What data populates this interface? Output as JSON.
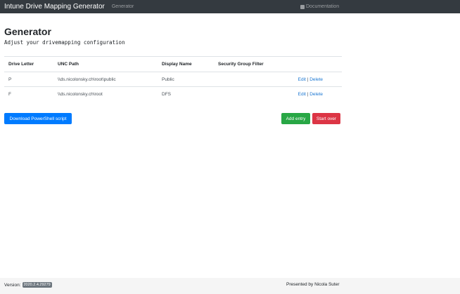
{
  "navbar": {
    "brand": "Intune Drive Mapping Generator",
    "nav_generator": "Generator",
    "documentation": "Documentation",
    "documentation_icon": "book-icon"
  },
  "main": {
    "title": "Generator",
    "subtitle": "Adjust your drivemapping configuration"
  },
  "table": {
    "headers": [
      "Drive Letter",
      "UNC Path",
      "Display Name",
      "Security Group Filter",
      ""
    ],
    "rows": [
      {
        "drive": "P",
        "unc": "\\\\ds.nicolonsky.ch\\root\\public",
        "display": "Public",
        "group": "",
        "edit": "Edit",
        "sep": "|",
        "delete": "Delete"
      },
      {
        "drive": "F",
        "unc": "\\\\ds.nicolonsky.ch\\root",
        "display": "DFS",
        "group": "",
        "edit": "Edit",
        "sep": "|",
        "delete": "Delete"
      }
    ]
  },
  "buttons": {
    "download": "Download PowerShell script",
    "add": "Add entry",
    "start_over": "Start over"
  },
  "colors": {
    "navbar": "#343a40",
    "primary": "#007bff",
    "success": "#28a745",
    "danger": "#dc3545"
  },
  "footer": {
    "version_label": "Version:",
    "version_value": "2020.2.4.29279",
    "presented": "Presented by Nicola Suter"
  }
}
